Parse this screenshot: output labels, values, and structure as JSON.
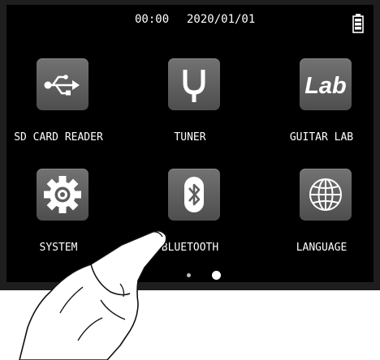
{
  "status_bar": {
    "time": "00:00",
    "date": "2020/01/01",
    "battery_icon": "battery-full-icon"
  },
  "apps": [
    {
      "label": "SD CARD READER",
      "icon": "usb-icon"
    },
    {
      "label": "TUNER",
      "icon": "tuner-icon"
    },
    {
      "label": "GUITAR LAB",
      "icon": "lab-icon",
      "icon_text": "Lab"
    },
    {
      "label": "SYSTEM",
      "icon": "gear-icon"
    },
    {
      "label": "BLUETOOTH",
      "icon": "bluetooth-icon"
    },
    {
      "label": "LANGUAGE",
      "icon": "globe-icon"
    }
  ],
  "pagination": {
    "pages": 2,
    "current": 2
  },
  "colors": {
    "screen_background": "#000000",
    "tile_background": "#5e5e5e",
    "text": "#ffffff"
  }
}
